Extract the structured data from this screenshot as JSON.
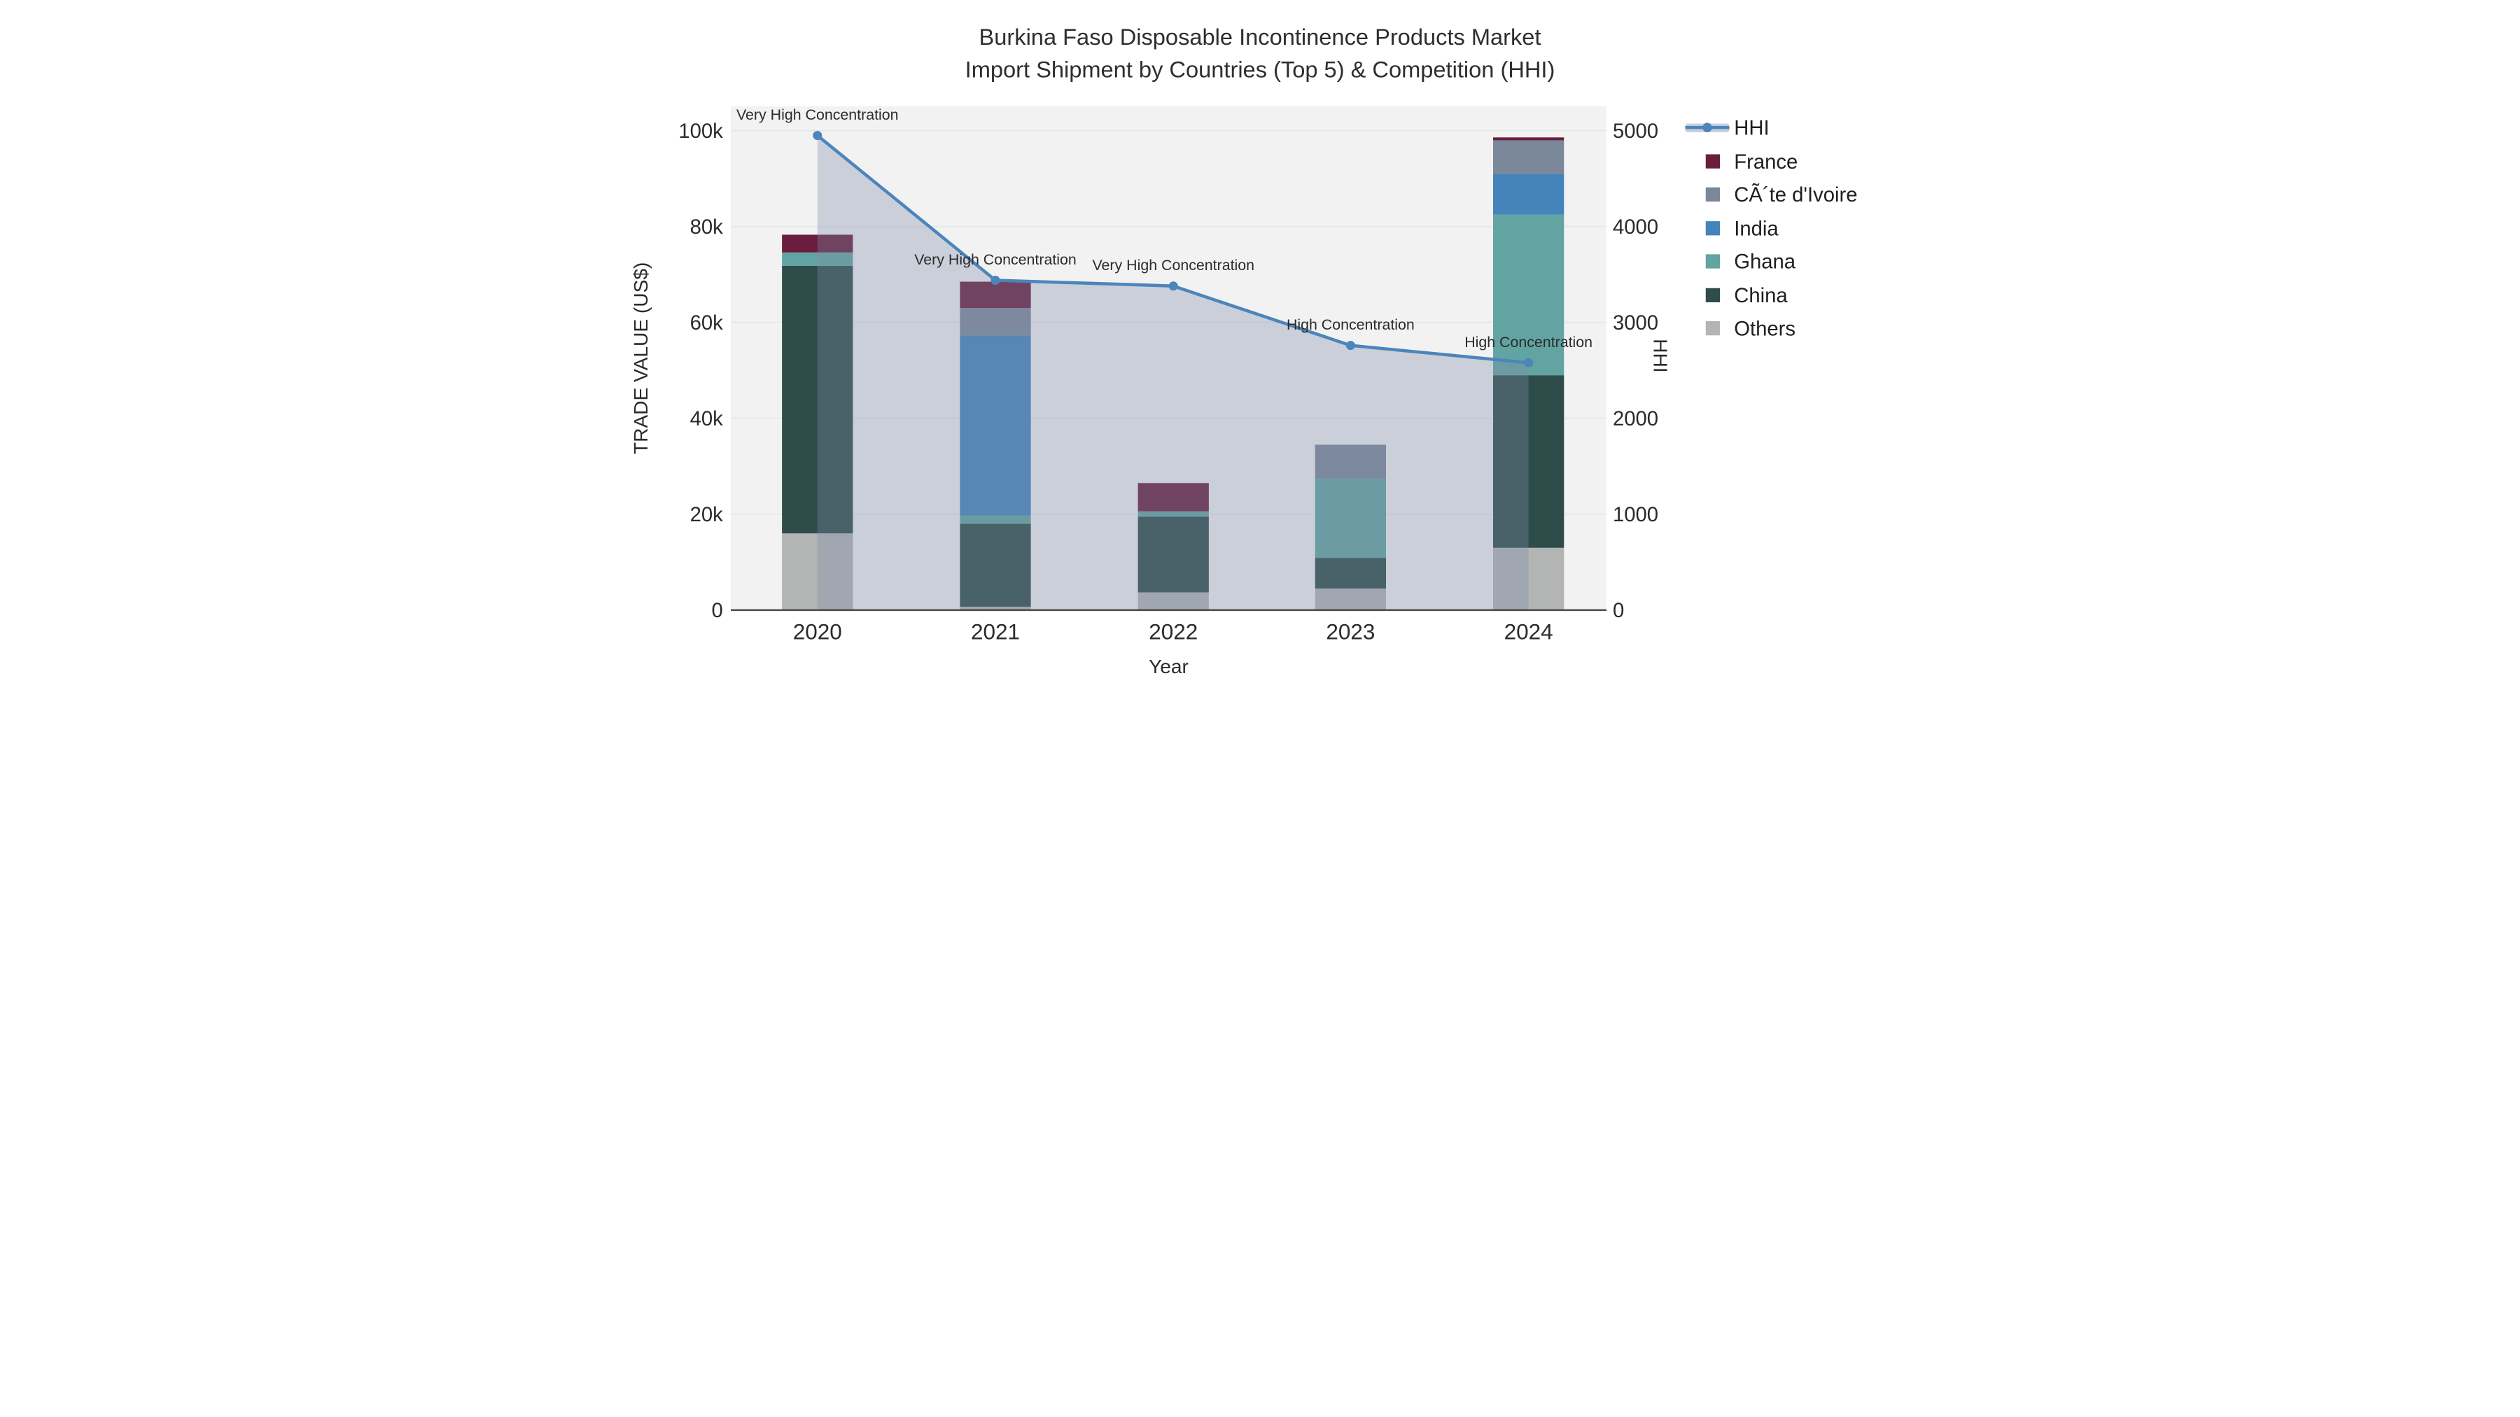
{
  "title": {
    "line1": "Burkina Faso Disposable Incontinence Products Market",
    "line2": "Import Shipment by Countries (Top 5) & Competition (HHI)"
  },
  "chart_data": {
    "type": "combo: stacked bar (trade value by country) + line with area fill (HHI)",
    "categories": [
      "2020",
      "2021",
      "2022",
      "2023",
      "2024"
    ],
    "xlabel": "Year",
    "series": [
      {
        "name": "Others",
        "color": "#b3b5b4",
        "values": [
          16000,
          700,
          3700,
          4500,
          13000
        ]
      },
      {
        "name": "China",
        "color": "#2e4c4a",
        "values": [
          55800,
          17300,
          15800,
          6400,
          36000
        ]
      },
      {
        "name": "Ghana",
        "color": "#62a4a2",
        "values": [
          2800,
          1700,
          1100,
          16500,
          33500
        ]
      },
      {
        "name": "India",
        "color": "#4583bb",
        "values": [
          0,
          37600,
          0,
          0,
          8500
        ]
      },
      {
        "name": "CÃ´te d'Ivoire",
        "color": "#7b8899",
        "values": [
          0,
          5700,
          0,
          7100,
          7000
        ]
      },
      {
        "name": "France",
        "color": "#6b1d3e",
        "values": [
          3700,
          5500,
          5900,
          0,
          600
        ]
      }
    ],
    "line": {
      "name": "HHI",
      "color": "#4b85bb",
      "area_fill": "rgba(127,142,171,0.34)",
      "values": [
        4950,
        3440,
        3380,
        2760,
        2580
      ]
    },
    "annotations": [
      "Very High Concentration",
      "Very High Concentration",
      "Very High Concentration",
      "High Concentration",
      "High Concentration"
    ],
    "yaxis_left": {
      "title": "TRADE VALUE (US$)",
      "ticks": [
        "0",
        "20k",
        "40k",
        "60k",
        "80k",
        "100k"
      ],
      "tick_values": [
        0,
        20000,
        40000,
        60000,
        80000,
        100000
      ],
      "range": [
        0,
        100000
      ]
    },
    "yaxis_right": {
      "title": "HHI",
      "ticks": [
        "0",
        "1000",
        "2000",
        "3000",
        "4000",
        "5000"
      ],
      "tick_values": [
        0,
        1000,
        2000,
        3000,
        4000,
        5000
      ],
      "range": [
        0,
        5000
      ]
    },
    "legend": [
      {
        "label": "HHI",
        "marker": "line",
        "color": "#4b85bb",
        "band_color": "#c8cedb"
      },
      {
        "label": "France",
        "marker": "square",
        "color": "#6b1d3e"
      },
      {
        "label": "CÃ´te d'Ivoire",
        "marker": "square",
        "color": "#7b8899"
      },
      {
        "label": "India",
        "marker": "square",
        "color": "#4583bb"
      },
      {
        "label": "Ghana",
        "marker": "square",
        "color": "#62a4a2"
      },
      {
        "label": "China",
        "marker": "square",
        "color": "#2e4c4a"
      },
      {
        "label": "Others",
        "marker": "square",
        "color": "#b3b5b4"
      }
    ],
    "plot_background": "#f2f2f2",
    "grid": "on",
    "legend_position": "right"
  }
}
